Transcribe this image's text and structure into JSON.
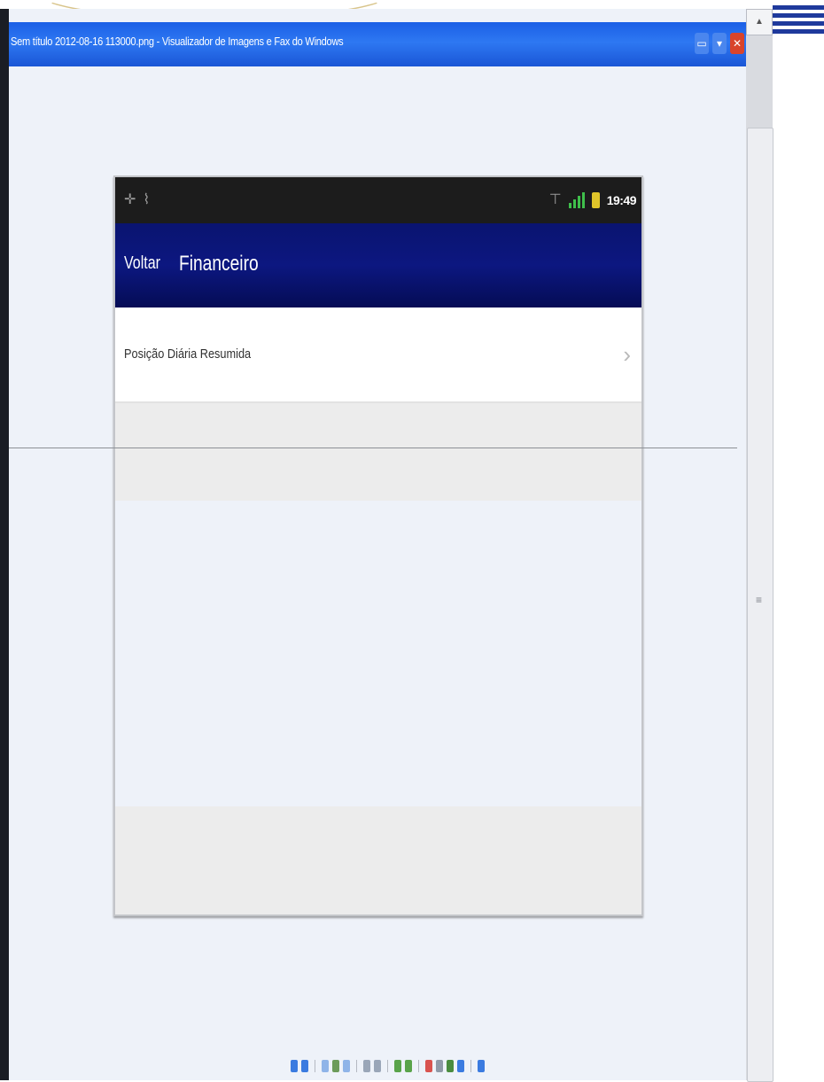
{
  "window": {
    "title": "Sem título 2012-08-16 113000.png - Visualizador de Imagens e Fax do Windows",
    "buttons": [
      "▭",
      "▾",
      "✕"
    ]
  },
  "phone": {
    "status_bar": {
      "clock": "19:49",
      "left_icons": [
        "usb-icon",
        "debug-icon"
      ],
      "right_icons": [
        "wifi-icon",
        "signal-icon",
        "battery-icon"
      ],
      "colors": {
        "signal": "#3fbf4b",
        "battery": "#e0c52a"
      }
    },
    "action_bar": {
      "back_label": "Voltar",
      "title": "Financeiro",
      "background": "#0c1780"
    },
    "list": [
      {
        "label": "Posição Diária Resumida",
        "chevron": "›"
      }
    ]
  },
  "scrollbar": {
    "up_arrow": "▲",
    "grip": "≡"
  },
  "toolbar": {
    "icons": [
      "prev-icon",
      "next-icon",
      "best-fit-icon",
      "actual-size-icon",
      "slideshow-icon",
      "zoom-in-icon",
      "zoom-out-icon",
      "rotate-cw-icon",
      "rotate-ccw-icon",
      "delete-icon",
      "print-icon",
      "copy-icon",
      "edit-icon",
      "help-icon"
    ]
  }
}
